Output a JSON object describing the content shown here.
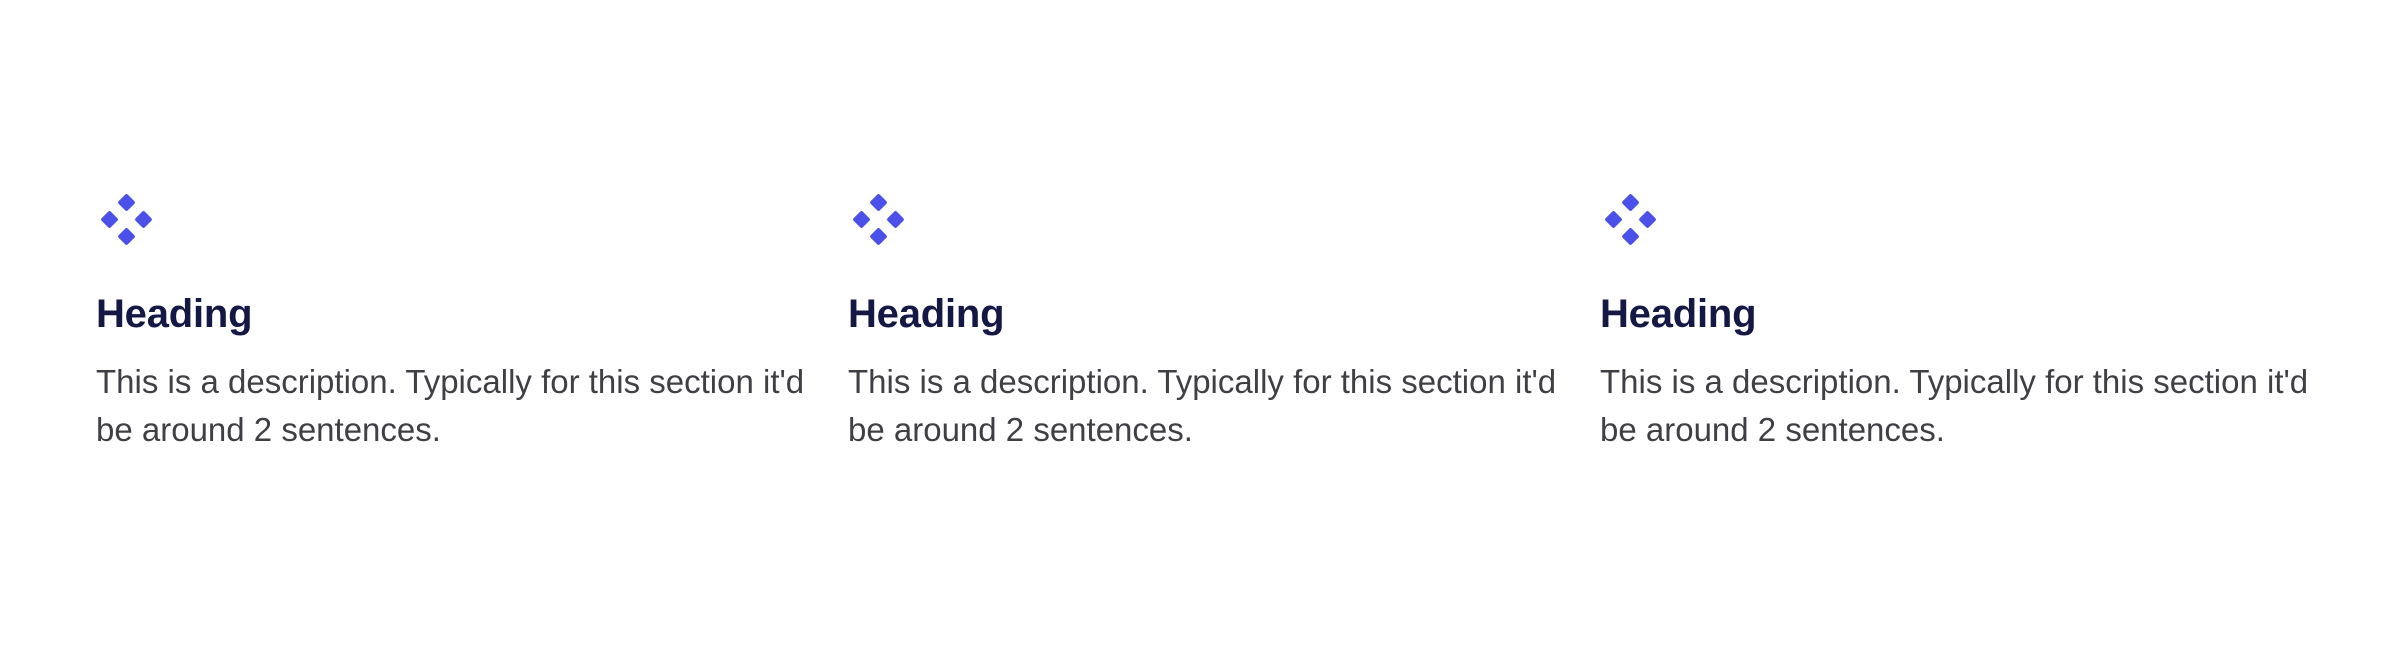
{
  "colors": {
    "accent": "#4a50e8",
    "heading": "#141844",
    "body_text": "#3f3f46",
    "background": "#ffffff"
  },
  "features": [
    {
      "icon": "diamond-cluster-icon",
      "heading": "Heading",
      "description": "This is a description. Typically for this section it'd be around 2 sentences."
    },
    {
      "icon": "diamond-cluster-icon",
      "heading": "Heading",
      "description": "This is a description. Typically for this section it'd be around 2 sentences."
    },
    {
      "icon": "diamond-cluster-icon",
      "heading": "Heading",
      "description": "This is a description. Typically for this section it'd be around 2 sentences."
    }
  ]
}
